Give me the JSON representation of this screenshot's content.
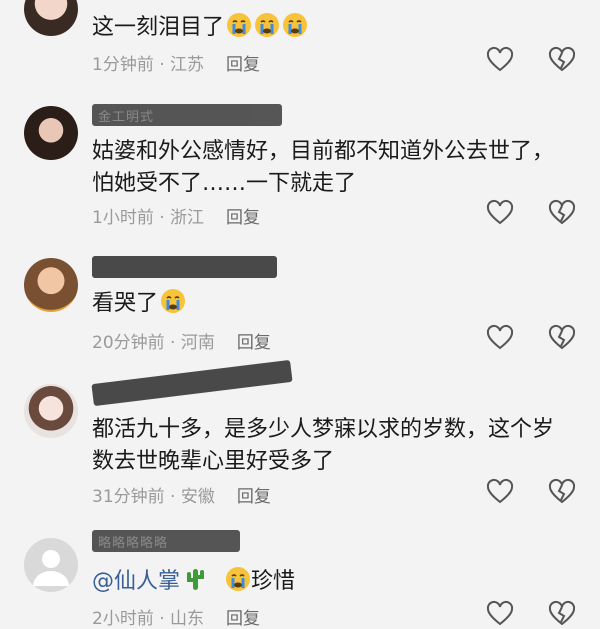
{
  "comments": [
    {
      "name": "",
      "text": "这一刻泪目了",
      "emojis": 3,
      "time": "1分钟前",
      "location": "江苏",
      "reply": "回复"
    },
    {
      "name": "金工明式",
      "text": "姑婆和外公感情好，目前都不知道外公去世了，怕她受不了……一下就走了",
      "emojis": 0,
      "time": "1小时前",
      "location": "浙江",
      "reply": "回复"
    },
    {
      "name": "",
      "text": "看哭了",
      "emojis": 1,
      "time": "20分钟前",
      "location": "河南",
      "reply": "回复"
    },
    {
      "name": "",
      "text": "都活九十多，是多少人梦寐以求的岁数，这个岁数去世晚辈心里好受多了",
      "emojis": 0,
      "time": "31分钟前",
      "location": "安徽",
      "reply": "回复"
    },
    {
      "name": "略略略略略",
      "mention": "@仙人掌",
      "text": "珍惜",
      "emojis": 1,
      "time": "2小时前",
      "location": "山东",
      "reply": "回复"
    }
  ],
  "icons": {
    "like": "heart-outline-icon",
    "dislike": "broken-heart-icon",
    "crying": "crying-face-emoji",
    "cactus": "cactus-emoji"
  },
  "colors": {
    "background": "#f3f3f3",
    "meta": "#9a9a9a",
    "emoji_face": "#f7c33b",
    "emoji_tear": "#3b8be3"
  }
}
